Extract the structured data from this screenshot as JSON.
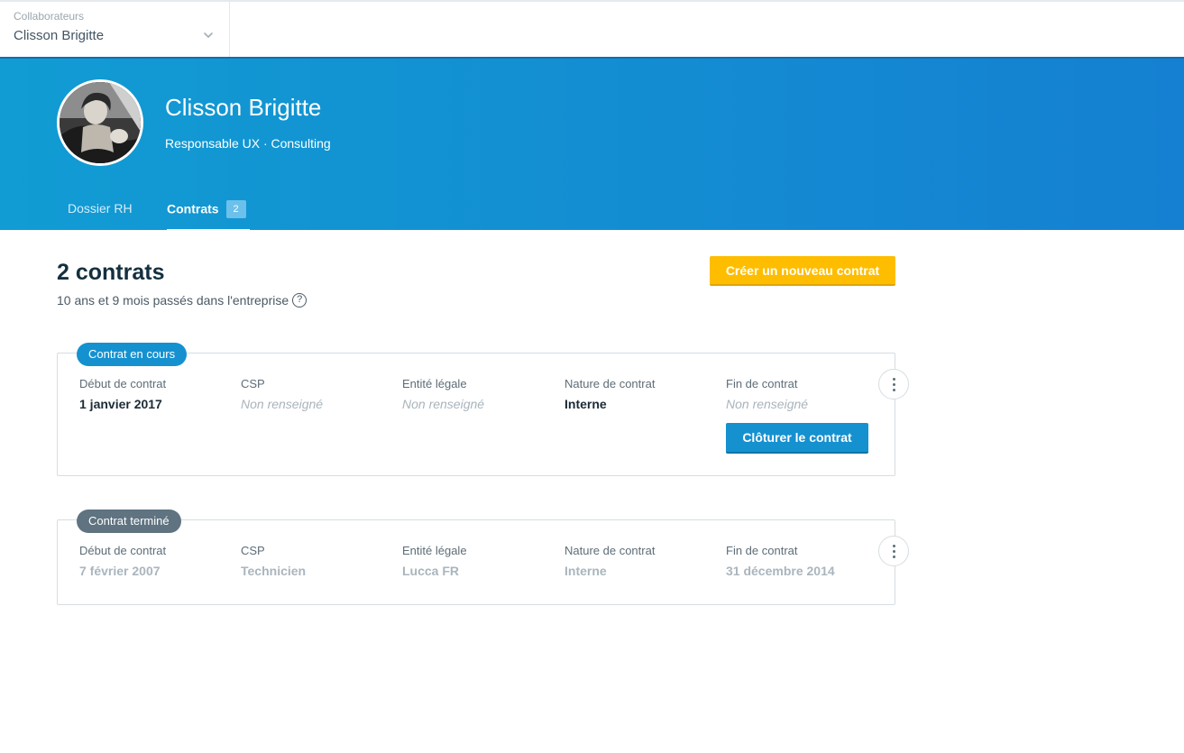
{
  "selector": {
    "label": "Collaborateurs",
    "value": "Clisson Brigitte",
    "icon": "chevron-down-icon"
  },
  "profile": {
    "name": "Clisson Brigitte",
    "role": "Responsable UX · Consulting"
  },
  "tabs": [
    {
      "label": "Dossier RH",
      "active": false
    },
    {
      "label": "Contrats",
      "active": true,
      "badge": "2"
    }
  ],
  "summary": {
    "title": "2 contrats",
    "tenure": "10 ans et 9 mois passés dans l'entreprise",
    "help_icon": "?"
  },
  "actions": {
    "new_contract": "Créer un nouveau contrat"
  },
  "contracts": [
    {
      "status": "Contrat en cours",
      "fields": [
        {
          "label": "Début de contrat",
          "value": "1 janvier 2017"
        },
        {
          "label": "CSP",
          "value": "Non renseigné"
        },
        {
          "label": "Entité légale",
          "value": "Non renseigné"
        },
        {
          "label": "Nature de contrat",
          "value": "Interne"
        },
        {
          "label": "Fin de contrat",
          "value": "Non renseigné"
        }
      ],
      "close_label": "Clôturer le contrat"
    },
    {
      "status": "Contrat terminé",
      "fields": [
        {
          "label": "Début de contrat",
          "value": "7 février 2007"
        },
        {
          "label": "CSP",
          "value": "Technicien"
        },
        {
          "label": "Entité légale",
          "value": "Lucca FR"
        },
        {
          "label": "Nature de contrat",
          "value": "Interne"
        },
        {
          "label": "Fin de contrat",
          "value": "31 décembre 2014"
        }
      ]
    }
  ],
  "colors": {
    "header_start": "#119cd3",
    "header_end": "#1580d1",
    "primary_button": "#ffbd00",
    "close_button": "#1591d0",
    "pill_current": "#1591d0",
    "pill_ended": "#5f7380"
  }
}
